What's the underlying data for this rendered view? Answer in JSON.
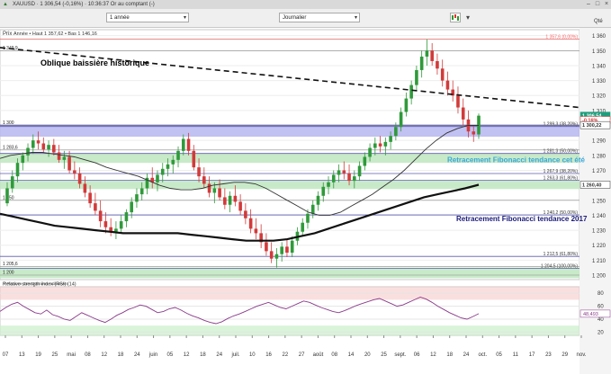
{
  "window": {
    "title": "XAUUSD · 1 306,54 (-0,16%) · 10:36:37 Or au comptant (-)",
    "close": "×",
    "minimize": "–",
    "maximize": "□"
  },
  "toolbar": {
    "period": "1 année",
    "interval": "Journalier",
    "chart_style_icon": "candlestick-icon",
    "quantity_label": "Qté"
  },
  "chart_data": [
    {
      "type": "candlestick",
      "panel": "price",
      "panel_label": "Prix",
      "header_info": "Année • Haut 1 357,62 • Bas 1 146,16",
      "source_note": "IT-Finance.com Données indicatives",
      "y_ticks": [
        1200,
        1210,
        1220,
        1230,
        1240,
        1250,
        1260,
        1270,
        1280,
        1290,
        1300,
        1310,
        1320,
        1330,
        1340,
        1350,
        1360
      ],
      "y_tick_labels": [
        "1 200",
        "1 210",
        "1 220",
        "1 230",
        "1 240",
        "1 250",
        "1 260",
        "1 270",
        "1 280",
        "1 290",
        "1 300",
        "1 310",
        "1 320",
        "1 330",
        "1 340",
        "1 350",
        "1 360"
      ],
      "ylim": [
        1197,
        1364
      ],
      "x_ticks": [
        "07",
        "13",
        "19",
        "25",
        "mai",
        "08",
        "12",
        "18",
        "24",
        "juin",
        "05",
        "12",
        "18",
        "24",
        "juil.",
        "10",
        "16",
        "22",
        "27",
        "août",
        "08",
        "14",
        "20",
        "25",
        "sept.",
        "06",
        "12",
        "18",
        "24",
        "oct.",
        "05",
        "11",
        "17",
        "23",
        "29",
        "nov."
      ],
      "last_price": "1 306,54",
      "last_change": "-0,16%",
      "right_markers": [
        {
          "label": "1 357,6 (0,00%)",
          "value": 1357.6,
          "color": "#ff6666"
        },
        {
          "label": "1 299,3 (38,20%)",
          "value": 1299.3,
          "color": "#333333"
        },
        {
          "label": "1 281,3 (50,00%)",
          "value": 1281.3,
          "color": "#333333"
        },
        {
          "label": "1 267,9 (38,20%)",
          "value": 1267.9,
          "color": "#333333"
        },
        {
          "label": "1 263,3 (61,80%)",
          "value": 1263.3,
          "color": "#333333"
        },
        {
          "label": "1 240,2 (50,00%)",
          "value": 1240.2,
          "color": "#333333"
        },
        {
          "label": "1 212,5 (61,80%)",
          "value": 1212.5,
          "color": "#333333"
        },
        {
          "label": "1 204,5 (100,00%)",
          "value": 1204.5,
          "color": "#333333"
        }
      ],
      "right_badges": [
        {
          "label": "1 306,54",
          "value": 1306.54,
          "color": "#1f9e7d"
        },
        {
          "label": "-0,16%",
          "value": 1303.6,
          "color": "#e03030"
        },
        {
          "label": "1 300,22",
          "value": 1300.22,
          "color": "#333333"
        },
        {
          "label": "1 260,40",
          "value": 1260.4,
          "color": "#333333"
        }
      ],
      "left_labels": [
        {
          "label": "1 349,9",
          "value": 1349.9
        },
        {
          "label": "1 300",
          "value": 1300.0
        },
        {
          "label": "1 283,6",
          "value": 1283.6
        },
        {
          "label": "1 250",
          "value": 1250.0
        },
        {
          "label": "1 205,6",
          "value": 1205.6
        },
        {
          "label": "1 200",
          "value": 1200.0
        }
      ],
      "zones": [
        {
          "from": 1292.5,
          "to": 1300.2,
          "color": "#b6b6f0"
        },
        {
          "from": 1275.0,
          "to": 1281.3,
          "color": "#bfe6bf"
        },
        {
          "from": 1257.5,
          "to": 1263.3,
          "color": "#bfe6bf"
        },
        {
          "from": 1198.0,
          "to": 1205.0,
          "color": "#bfe6bf"
        }
      ],
      "annotations": [
        {
          "text": "Oblique baissière historique",
          "color": "#000000"
        },
        {
          "text": "Retracement Fibonacci tendance cet été",
          "color": "#3aa8d8"
        },
        {
          "text": "Retracement Fibonacci tendance 2017",
          "color": "#1a1a7a"
        }
      ],
      "candles_ohlc": [
        [
          1248,
          1262,
          1246,
          1258
        ],
        [
          1258,
          1270,
          1255,
          1266
        ],
        [
          1266,
          1278,
          1262,
          1275
        ],
        [
          1275,
          1282,
          1270,
          1280
        ],
        [
          1280,
          1288,
          1276,
          1285
        ],
        [
          1285,
          1294,
          1281,
          1290
        ],
        [
          1290,
          1296,
          1284,
          1288
        ],
        [
          1288,
          1292,
          1282,
          1284
        ],
        [
          1284,
          1290,
          1279,
          1287
        ],
        [
          1287,
          1291,
          1280,
          1282
        ],
        [
          1282,
          1287,
          1275,
          1277
        ],
        [
          1277,
          1283,
          1271,
          1279
        ],
        [
          1279,
          1283,
          1268,
          1270
        ],
        [
          1270,
          1276,
          1264,
          1268
        ],
        [
          1268,
          1272,
          1258,
          1261
        ],
        [
          1261,
          1266,
          1252,
          1255
        ],
        [
          1255,
          1260,
          1245,
          1248
        ],
        [
          1248,
          1255,
          1240,
          1243
        ],
        [
          1243,
          1250,
          1232,
          1236
        ],
        [
          1236,
          1242,
          1228,
          1232
        ],
        [
          1232,
          1238,
          1226,
          1229
        ],
        [
          1229,
          1236,
          1224,
          1231
        ],
        [
          1231,
          1240,
          1228,
          1236
        ],
        [
          1236,
          1244,
          1232,
          1242
        ],
        [
          1242,
          1252,
          1238,
          1249
        ],
        [
          1249,
          1258,
          1245,
          1254
        ],
        [
          1254,
          1262,
          1250,
          1258
        ],
        [
          1258,
          1268,
          1254,
          1265
        ],
        [
          1265,
          1272,
          1258,
          1262
        ],
        [
          1262,
          1270,
          1256,
          1267
        ],
        [
          1267,
          1275,
          1262,
          1271
        ],
        [
          1271,
          1278,
          1266,
          1274
        ],
        [
          1274,
          1280,
          1268,
          1277
        ],
        [
          1277,
          1286,
          1272,
          1283
        ],
        [
          1283,
          1294,
          1280,
          1291
        ],
        [
          1291,
          1295,
          1280,
          1283
        ],
        [
          1283,
          1287,
          1270,
          1272
        ],
        [
          1272,
          1278,
          1262,
          1266
        ],
        [
          1266,
          1272,
          1258,
          1261
        ],
        [
          1261,
          1266,
          1252,
          1255
        ],
        [
          1255,
          1262,
          1248,
          1258
        ],
        [
          1258,
          1264,
          1250,
          1252
        ],
        [
          1252,
          1258,
          1244,
          1247
        ],
        [
          1247,
          1256,
          1242,
          1253
        ],
        [
          1253,
          1260,
          1246,
          1249
        ],
        [
          1249,
          1254,
          1240,
          1243
        ],
        [
          1243,
          1248,
          1234,
          1238
        ],
        [
          1238,
          1244,
          1228,
          1231
        ],
        [
          1231,
          1238,
          1224,
          1228
        ],
        [
          1228,
          1234,
          1218,
          1222
        ],
        [
          1222,
          1228,
          1213,
          1216
        ],
        [
          1216,
          1222,
          1208,
          1211
        ],
        [
          1211,
          1218,
          1205,
          1214
        ],
        [
          1214,
          1222,
          1209,
          1219
        ],
        [
          1219,
          1224,
          1212,
          1215
        ],
        [
          1215,
          1226,
          1212,
          1223
        ],
        [
          1223,
          1232,
          1220,
          1229
        ],
        [
          1229,
          1238,
          1226,
          1235
        ],
        [
          1235,
          1244,
          1231,
          1241
        ],
        [
          1241,
          1250,
          1238,
          1247
        ],
        [
          1247,
          1256,
          1243,
          1253
        ],
        [
          1253,
          1262,
          1249,
          1259
        ],
        [
          1259,
          1266,
          1254,
          1262
        ],
        [
          1262,
          1270,
          1258,
          1267
        ],
        [
          1267,
          1274,
          1262,
          1270
        ],
        [
          1270,
          1276,
          1264,
          1268
        ],
        [
          1268,
          1274,
          1260,
          1263
        ],
        [
          1263,
          1270,
          1258,
          1266
        ],
        [
          1266,
          1276,
          1263,
          1273
        ],
        [
          1273,
          1282,
          1270,
          1279
        ],
        [
          1279,
          1288,
          1276,
          1285
        ],
        [
          1285,
          1292,
          1280,
          1288
        ],
        [
          1288,
          1293,
          1282,
          1286
        ],
        [
          1286,
          1292,
          1280,
          1289
        ],
        [
          1289,
          1296,
          1284,
          1293
        ],
        [
          1293,
          1302,
          1290,
          1299
        ],
        [
          1299,
          1312,
          1296,
          1309
        ],
        [
          1309,
          1322,
          1306,
          1318
        ],
        [
          1318,
          1330,
          1314,
          1327
        ],
        [
          1327,
          1340,
          1323,
          1337
        ],
        [
          1337,
          1350,
          1332,
          1346
        ],
        [
          1346,
          1357.6,
          1340,
          1350
        ],
        [
          1350,
          1355,
          1340,
          1343
        ],
        [
          1343,
          1348,
          1334,
          1338
        ],
        [
          1338,
          1344,
          1326,
          1330
        ],
        [
          1330,
          1336,
          1320,
          1324
        ],
        [
          1324,
          1330,
          1316,
          1320
        ],
        [
          1320,
          1326,
          1308,
          1312
        ],
        [
          1312,
          1318,
          1300,
          1304
        ],
        [
          1304,
          1310,
          1292,
          1296
        ],
        [
          1296,
          1300,
          1289,
          1294
        ],
        [
          1294,
          1308,
          1291,
          1306.54
        ]
      ],
      "series": [
        {
          "name": "",
          "values": [
            1278,
            1280,
            1281,
            1282,
            1282,
            1281,
            1280,
            1279,
            1277,
            1275,
            1272,
            1270,
            1268,
            1266,
            1263,
            1260,
            1258,
            1257,
            1257,
            1258,
            1260,
            1261,
            1262,
            1262,
            1261,
            1258,
            1254,
            1250,
            1246,
            1242,
            1240,
            1240,
            1242,
            1246,
            1250,
            1254,
            1259,
            1264,
            1270,
            1277,
            1284,
            1290,
            1295,
            1298,
            1300,
            1300
          ]
        },
        {
          "name": "",
          "values": [
            1241,
            1239,
            1237,
            1235,
            1233,
            1232,
            1231,
            1230,
            1229,
            1228,
            1228,
            1228,
            1228,
            1228,
            1227,
            1226,
            1225,
            1224,
            1223,
            1223,
            1223,
            1224,
            1226,
            1228,
            1231,
            1234,
            1237,
            1240,
            1243,
            1246,
            1249,
            1252,
            1254,
            1256,
            1258,
            1260.4
          ]
        }
      ]
    },
    {
      "type": "line",
      "panel": "rsi",
      "panel_label": "Relative strength index (RSI) (14)",
      "ylim": [
        15,
        90
      ],
      "y_ticks": [
        20,
        40,
        60,
        80
      ],
      "y_tick_labels": [
        "20",
        "40",
        "60",
        "80"
      ],
      "last_value": "48,493",
      "overbought": 70,
      "oversold": 30,
      "series": [
        {
          "name": "",
          "values": [
            52,
            58,
            63,
            66,
            60,
            55,
            50,
            48,
            54,
            47,
            44,
            40,
            38,
            44,
            50,
            46,
            42,
            38,
            35,
            40,
            46,
            50,
            55,
            58,
            62,
            60,
            55,
            50,
            52,
            56,
            58,
            54,
            49,
            45,
            42,
            38,
            35,
            33,
            36,
            41,
            45,
            48,
            52,
            56,
            60,
            63,
            66,
            62,
            58,
            56,
            60,
            64,
            68,
            66,
            62,
            58,
            55,
            52,
            50,
            53,
            57,
            61,
            64,
            67,
            70,
            72,
            68,
            64,
            60,
            62,
            66,
            70,
            74,
            71,
            66,
            60,
            55,
            50,
            46,
            42,
            40,
            44,
            48.493
          ]
        }
      ]
    }
  ]
}
